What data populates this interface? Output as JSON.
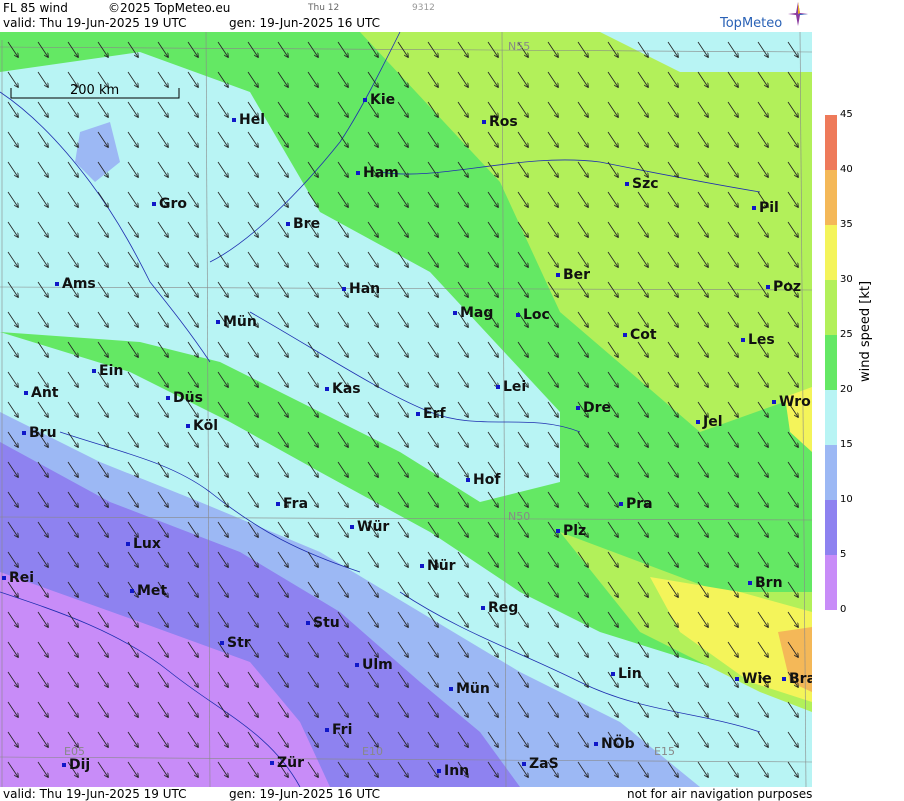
{
  "header": {
    "product": "FL 85 wind",
    "copyright": "©2025 TopMeteo.eu",
    "small_time": "Thu 12",
    "small_code": "9312",
    "valid": "valid:  Thu  19-Jun-2025  19 UTC",
    "gen": "gen: 19-Jun-2025 16 UTC",
    "brand": "TopMeteo"
  },
  "footer": {
    "valid": "valid:  Thu  19-Jun-2025  19 UTC",
    "gen": "gen: 19-Jun-2025 16 UTC",
    "notice": "not for air navigation purposes"
  },
  "scale_bar": {
    "label": "200 km"
  },
  "grid_labels": [
    "N55",
    "N50",
    "E05",
    "E10",
    "E15"
  ],
  "legend": {
    "title": "wind speed [kt]",
    "ticks": [
      0,
      5,
      10,
      15,
      20,
      25,
      30,
      35,
      40,
      45
    ],
    "colors": {
      "0-5": "#c88cf8",
      "5-10": "#8e82f0",
      "10-15": "#9cb8f4",
      "15-20": "#b8f4f4",
      "20-25": "#64e864",
      "25-30": "#b2f05a",
      "30-35": "#f4f45a",
      "35-40": "#f4b858",
      "40-45": "#ee7a5a"
    }
  },
  "cities": [
    "Hel",
    "Kie",
    "Ros",
    "Ham",
    "Szc",
    "Gro",
    "Bre",
    "Pil",
    "Ber",
    "Poz",
    "Ams",
    "Han",
    "Mag",
    "Loc",
    "Cot",
    "Les",
    "Mün",
    "Ein",
    "Kas",
    "Lei",
    "Ant",
    "Düs",
    "Wro",
    "Dre",
    "Erf",
    "Jel",
    "Köl",
    "Bru",
    "Hof",
    "Fra",
    "Pra",
    "Wür",
    "Plz",
    "Lux",
    "Nür",
    "Rei",
    "Met",
    "Brn",
    "Reg",
    "Stu",
    "Str",
    "Ulm",
    "Lin",
    "Wie",
    "Bra",
    "Mün",
    "Fri",
    "NÖb",
    "Dij",
    "Zür",
    "Inn",
    "ZaS"
  ]
}
